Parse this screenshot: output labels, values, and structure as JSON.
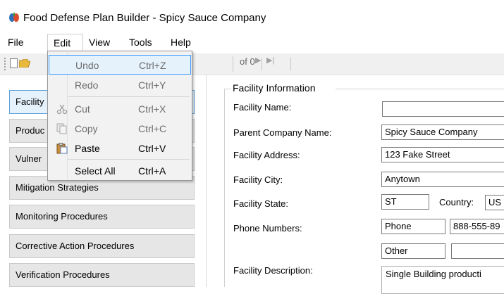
{
  "window": {
    "title": "Food Defense Plan Builder - Spicy Sauce Company",
    "app_icon": "app-logo-icon"
  },
  "menubar": {
    "items": [
      "File",
      "Edit",
      "View",
      "Tools",
      "Help"
    ],
    "open_menu": "Edit"
  },
  "toolbar": {
    "record_counter": "of 0",
    "new_icon": "new-document-icon",
    "open_icon": "open-folder-icon",
    "next_icon": "next-record-icon",
    "last_icon": "last-record-icon"
  },
  "edit_menu": {
    "items": [
      {
        "label": "Undo",
        "shortcut": "Ctrl+Z",
        "enabled": false,
        "icon": ""
      },
      {
        "label": "Redo",
        "shortcut": "Ctrl+Y",
        "enabled": false,
        "icon": ""
      },
      {
        "label": "Cut",
        "shortcut": "Ctrl+X",
        "enabled": false,
        "icon": "scissors-icon"
      },
      {
        "label": "Copy",
        "shortcut": "Ctrl+C",
        "enabled": false,
        "icon": "copy-icon"
      },
      {
        "label": "Paste",
        "shortcut": "Ctrl+V",
        "enabled": true,
        "icon": "paste-clipboard-icon"
      },
      {
        "label": "Select All",
        "shortcut": "Ctrl+A",
        "enabled": true,
        "icon": ""
      }
    ]
  },
  "sidebar": {
    "items": [
      {
        "label": "Facility"
      },
      {
        "label": "Produc"
      },
      {
        "label": "Vulner"
      },
      {
        "label": "Mitigation Strategies"
      },
      {
        "label": "Monitoring Procedures"
      },
      {
        "label": "Corrective Action Procedures"
      },
      {
        "label": "Verification Procedures"
      }
    ]
  },
  "facility_info": {
    "group_title": "Facility Information",
    "fields": {
      "name": {
        "label": "Facility Name:",
        "value": ""
      },
      "parent": {
        "label": "Parent Company Name:",
        "value": "Spicy Sauce Company"
      },
      "address": {
        "label": "Facility Address:",
        "value": "123 Fake Street"
      },
      "city": {
        "label": "Facility City:",
        "value": "Anytown"
      },
      "state": {
        "label": "Facility State:",
        "value": "ST"
      },
      "country": {
        "label": "Country:",
        "value": "US"
      },
      "phones": {
        "label": "Phone Numbers:",
        "phone_type": "Phone",
        "phone_value": "888-555-89",
        "other_type": "Other",
        "other_value": ""
      },
      "description": {
        "label": "Facility Description:",
        "value": "Single Building producti"
      }
    }
  }
}
